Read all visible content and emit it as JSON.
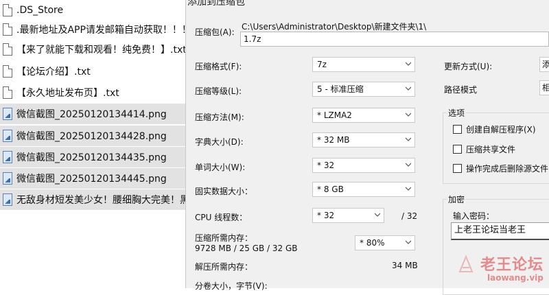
{
  "files": [
    {
      "name": ".DS_Store",
      "type": "doc",
      "selected": false
    },
    {
      "name": ".最新地址及APP请发邮箱自动获取！！！.",
      "type": "doc",
      "selected": false
    },
    {
      "name": "【来了就能下载和观看！纯免费！】.txt",
      "type": "doc",
      "selected": false
    },
    {
      "name": "【论坛介绍】.txt",
      "type": "doc",
      "selected": false
    },
    {
      "name": "【永久地址发布页】.txt",
      "type": "doc",
      "selected": false
    },
    {
      "name": "微信截图_20250120134414.png",
      "type": "img",
      "selected": true
    },
    {
      "name": "微信截图_20250120134428.png",
      "type": "img",
      "selected": true
    },
    {
      "name": "微信截图_20250120134435.png",
      "type": "img",
      "selected": true
    },
    {
      "name": "微信截图_20250120134445.png",
      "type": "img",
      "selected": true
    },
    {
      "name": "无敌身材短发美少女！腰细胸大完美！黑色",
      "type": "img",
      "selected": true
    }
  ],
  "dialog": {
    "title": "添加到压缩包",
    "archive_label": "压缩包(A):",
    "archive_dir": "C:\\Users\\Administrator\\Desktop\\新建文件夹\\1\\",
    "archive_name": "1.7z",
    "format_label": "压缩格式(F):",
    "format_value": "7z",
    "level_label": "压缩等级(L):",
    "level_value": "5 - 标准压缩",
    "method_label": "压缩方法(M):",
    "method_value": "*  LZMA2",
    "dict_label": "字典大小(D):",
    "dict_value": "*  32 MB",
    "word_label": "单词大小(W):",
    "word_value": "*  32",
    "solid_label": "固实数据大小：",
    "solid_value": "*  8 GB",
    "threads_label": "CPU 线程数：",
    "threads_value": "*  32",
    "threads_max": "/ 32",
    "mem_comp_label": "压缩所需内存：",
    "mem_comp_value": "9728 MB / 25 GB / 32 GB",
    "mem_percent": "*  80%",
    "mem_decomp_label": "解压所需内存：",
    "mem_decomp_value": "34 MB",
    "split_label": "分卷大小，字节(V):",
    "update_label": "更新方式(U):",
    "update_value": "添",
    "path_label": "路径模式",
    "path_value": "相",
    "options_title": "选项",
    "opt_sfx": "创建自解压程序(X)",
    "opt_shared": "压缩共享文件",
    "opt_delete": "操作完成后删除源文件",
    "encrypt_title": "加密",
    "password_label": "输入密码：",
    "password_value": "上老王论坛当老王"
  },
  "watermark": {
    "text": "老王论坛",
    "url": "laowang.vip"
  }
}
